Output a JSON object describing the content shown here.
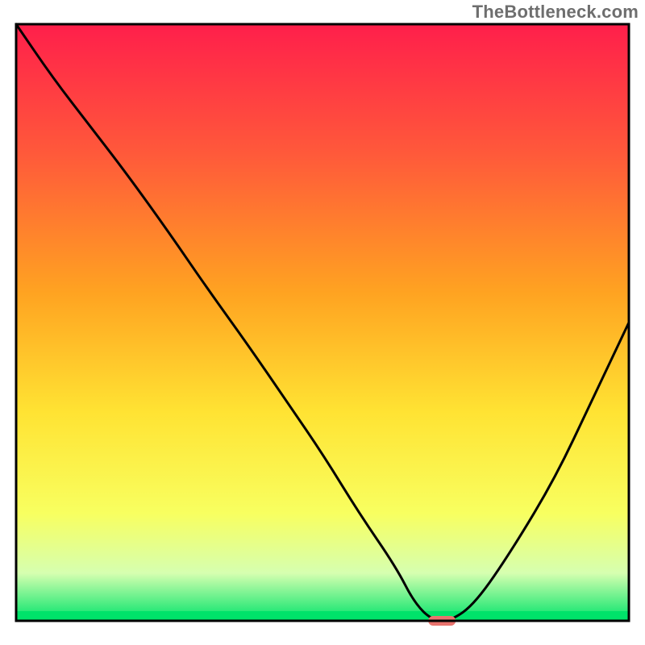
{
  "watermark": "TheBottleneck.com",
  "chart_data": {
    "type": "line",
    "title": "",
    "xlabel": "",
    "ylabel": "",
    "xlim": [
      0,
      100
    ],
    "ylim": [
      0,
      100
    ],
    "grid": false,
    "legend": false,
    "annotations": [],
    "description": "Bottleneck curve overlaid on a vertical red→green gradient with a thin green band at the bottom. Values are the curve's height (0 = bottom green band, 100 = top) at x positions across the plot width.",
    "series": [
      {
        "name": "curve",
        "x": [
          0,
          6,
          12,
          18,
          25,
          31,
          38,
          44,
          50,
          56,
          62,
          65,
          68,
          71,
          75,
          81,
          88,
          94,
          100
        ],
        "values": [
          100,
          91,
          83,
          75,
          65,
          56,
          46,
          37,
          28,
          18,
          9,
          3,
          0,
          0,
          3,
          12,
          24,
          37,
          50
        ]
      }
    ],
    "marker": {
      "x": 69.5,
      "y": 0,
      "color": "#e9736e"
    },
    "gradient_stops": [
      {
        "pct": 0,
        "color": "#ff1f4b"
      },
      {
        "pct": 22,
        "color": "#ff5a3a"
      },
      {
        "pct": 45,
        "color": "#ffa321"
      },
      {
        "pct": 65,
        "color": "#ffe333"
      },
      {
        "pct": 82,
        "color": "#f8ff60"
      },
      {
        "pct": 92,
        "color": "#d6ffb0"
      },
      {
        "pct": 100,
        "color": "#00e36a"
      }
    ],
    "bottom_band_color": "#00e36a",
    "frame_color": "#000000"
  }
}
